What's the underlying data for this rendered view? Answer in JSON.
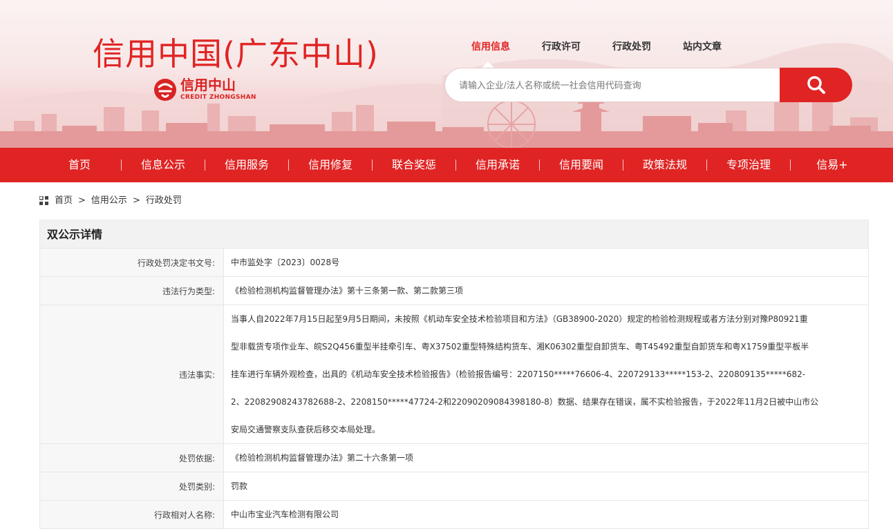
{
  "header": {
    "site_title": "信用中国(广东中山)",
    "logo_cn": "信用中山",
    "logo_en": "CREDIT ZHONGSHAN"
  },
  "top_nav": [
    {
      "label": "信用信息",
      "active": true
    },
    {
      "label": "行政许可",
      "active": false
    },
    {
      "label": "行政处罚",
      "active": false
    },
    {
      "label": "站内文章",
      "active": false
    }
  ],
  "search": {
    "placeholder": "请输入企业/法人名称或统一社会信用代码查询",
    "value": "",
    "button_icon": "search-icon"
  },
  "main_nav": [
    {
      "label": "首页"
    },
    {
      "label": "信息公示"
    },
    {
      "label": "信用服务"
    },
    {
      "label": "信用修复"
    },
    {
      "label": "联合奖惩"
    },
    {
      "label": "信用承诺"
    },
    {
      "label": "信用要闻"
    },
    {
      "label": "政策法规"
    },
    {
      "label": "专项治理"
    },
    {
      "label": "信易+"
    }
  ],
  "breadcrumb": {
    "icon": "grid-icon",
    "items": [
      "首页",
      "信用公示",
      "行政处罚"
    ],
    "separator": ">"
  },
  "detail": {
    "title": "双公示详情",
    "rows": [
      {
        "label": "行政处罚决定书文号:",
        "value": "中市监处字〔2023〕0028号"
      },
      {
        "label": "违法行为类型:",
        "value": "《检验检测机构监督管理办法》第十三条第一款、第二款第三项"
      },
      {
        "label": "违法事实:",
        "lines": [
          "当事人自2022年7月15日起至9月5日期间，未按照《机动车安全技术检验项目和方法》（GB38900-2020）规定的检验检测规程或者方法分别对豫P80921重",
          "型非载货专项作业车、皖S2Q456重型半挂牵引车、粤X37502重型特殊结构货车、湘K06302重型自卸货车、粤T45492重型自卸货车和粤X1759重型平板半",
          "挂车进行车辆外观检查，出具的《机动车安全技术检验报告》（检验报告编号：2207150*****76606-4、220729133*****153-2、220809135*****682-",
          "2、22082908243782688-2、2208150*****47724-2和22090209084398180-8）数据、结果存在错误，属不实检验报告，于2022年11月2日被中山市公",
          "安局交通警察支队查获后移交本局处理。"
        ]
      },
      {
        "label": "处罚依据:",
        "value": "《检验检测机构监督管理办法》第二十六条第一项"
      },
      {
        "label": "处罚类别:",
        "value": "罚款"
      },
      {
        "label": "行政相对人名称:",
        "value": "中山市宝业汽车检测有限公司"
      }
    ]
  },
  "colors": {
    "brand_red": "#e02424",
    "label_bg": "#f7f7f7",
    "title_bg": "#f2f2f2"
  }
}
